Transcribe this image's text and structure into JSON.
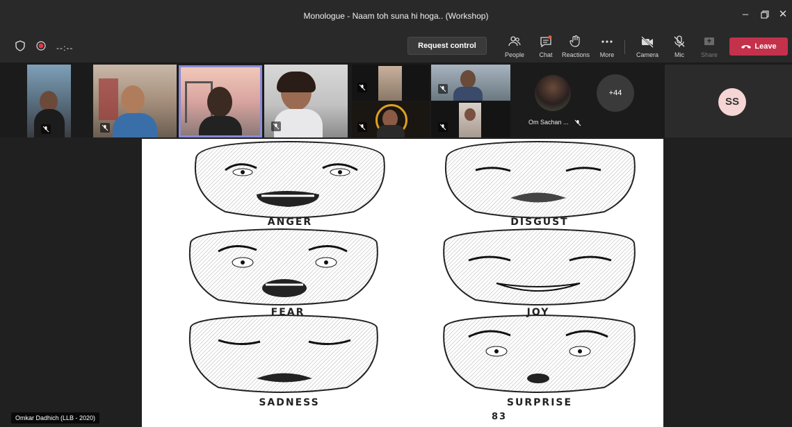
{
  "window": {
    "title": "Monologue - Naam toh suna hi hoga.. (Workshop)"
  },
  "toolbar": {
    "timer": "--:--",
    "request_control": "Request control",
    "people": "People",
    "chat": "Chat",
    "reactions": "Reactions",
    "more": "More",
    "camera": "Camera",
    "mic": "Mic",
    "share": "Share",
    "leave": "Leave"
  },
  "participants": {
    "named_tile": "Om Sachan ...",
    "overflow_count": "+44",
    "initials_tile": "SS"
  },
  "presenter": {
    "name": "Omkar Dadhich (LLB - 2020)"
  },
  "shared_content": {
    "labels": [
      "ANGER",
      "DISGUST",
      "FEAR",
      "JOY",
      "SADNESS",
      "SURPRISE"
    ],
    "page_number": "83"
  },
  "colors": {
    "leave": "#c4314b",
    "notification_dot": "#e35d3b",
    "active_speaker_border": "#8a8ad8"
  }
}
